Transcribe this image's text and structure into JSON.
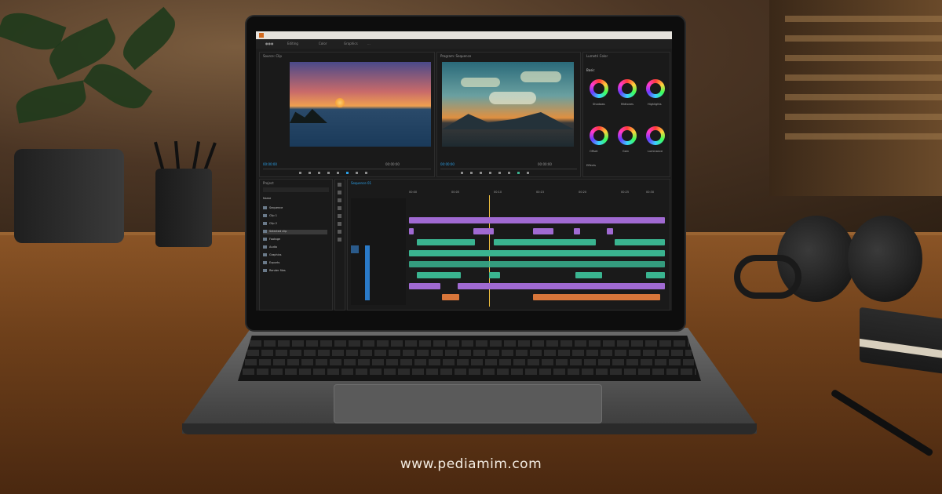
{
  "scene": {
    "description_colors": {
      "desk": "#6d3f1a",
      "wall": "#4b3524",
      "screen_bg": "#1c1c1c",
      "accent_blue": "#2aa0e8",
      "clip_purple": "#a06ad2",
      "clip_green": "#3ab490",
      "clip_orange": "#d8763a"
    }
  },
  "editor": {
    "menu": {
      "app_icon": "app-icon"
    },
    "titlebar": {
      "items": [
        "●●●",
        "Editing",
        "Color",
        "Graphics",
        "..."
      ]
    },
    "source_monitor": {
      "title": "Source: Clip",
      "timecode_left": "00:00:00",
      "timecode_right": "00:00:00"
    },
    "program_monitor": {
      "title": "Program: Sequence",
      "timecode_left": "00:00:00",
      "timecode_right": "00:00:00"
    },
    "color_panel": {
      "title": "Lumetri Color",
      "subtitle": "Basic",
      "wheels": [
        {
          "label": "Shadows"
        },
        {
          "label": "Midtones"
        },
        {
          "label": "Highlights"
        },
        {
          "label": "Offset"
        },
        {
          "label": "Gain"
        },
        {
          "label": "Luminance"
        }
      ],
      "footer": "Effects"
    },
    "project_panel": {
      "title": "Project",
      "header": "Name",
      "items": [
        "Sequence",
        "Clip 1",
        "Clip 2",
        "Selected clip",
        "Footage",
        "Audio",
        "Graphics",
        "Exports",
        "Render files"
      ]
    },
    "timeline": {
      "tab": "Sequence 01",
      "ruler": [
        "00:00",
        "00:05",
        "00:10",
        "00:15",
        "00:20",
        "00:25",
        "00:30"
      ]
    }
  },
  "watermark": "www.pediamim.com"
}
